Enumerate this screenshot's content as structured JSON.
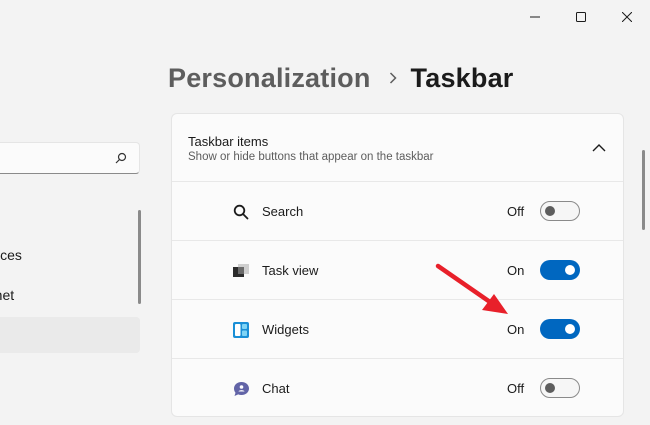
{
  "window": {
    "controls": [
      {
        "name": "minimize",
        "icon": "minimize-icon"
      },
      {
        "name": "maximize",
        "icon": "maximize-icon"
      },
      {
        "name": "close",
        "icon": "close-icon"
      }
    ]
  },
  "sidebar": {
    "search_placeholder": "",
    "items": [
      {
        "label": "vices",
        "selected": false
      },
      {
        "label": "rnet",
        "selected": false
      },
      {
        "label": "",
        "selected": true
      }
    ]
  },
  "breadcrumb": {
    "parent": "Personalization",
    "separator_icon": "chevron-right-icon",
    "current": "Taskbar"
  },
  "taskbar_items": {
    "title": "Taskbar items",
    "description": "Show or hide buttons that appear on the taskbar",
    "collapse_icon": "chevron-up-icon",
    "rows": [
      {
        "label": "Search",
        "state": "Off",
        "on": false,
        "icon": "search-icon"
      },
      {
        "label": "Task view",
        "state": "On",
        "on": true,
        "icon": "task-view-icon"
      },
      {
        "label": "Widgets",
        "state": "On",
        "on": true,
        "icon": "widgets-icon"
      },
      {
        "label": "Chat",
        "state": "Off",
        "on": false,
        "icon": "chat-icon"
      }
    ]
  },
  "colors": {
    "accent": "#0067c0",
    "annotation_arrow": "#e8202a",
    "background": "#f3f3f3",
    "card": "#fbfbfb"
  }
}
